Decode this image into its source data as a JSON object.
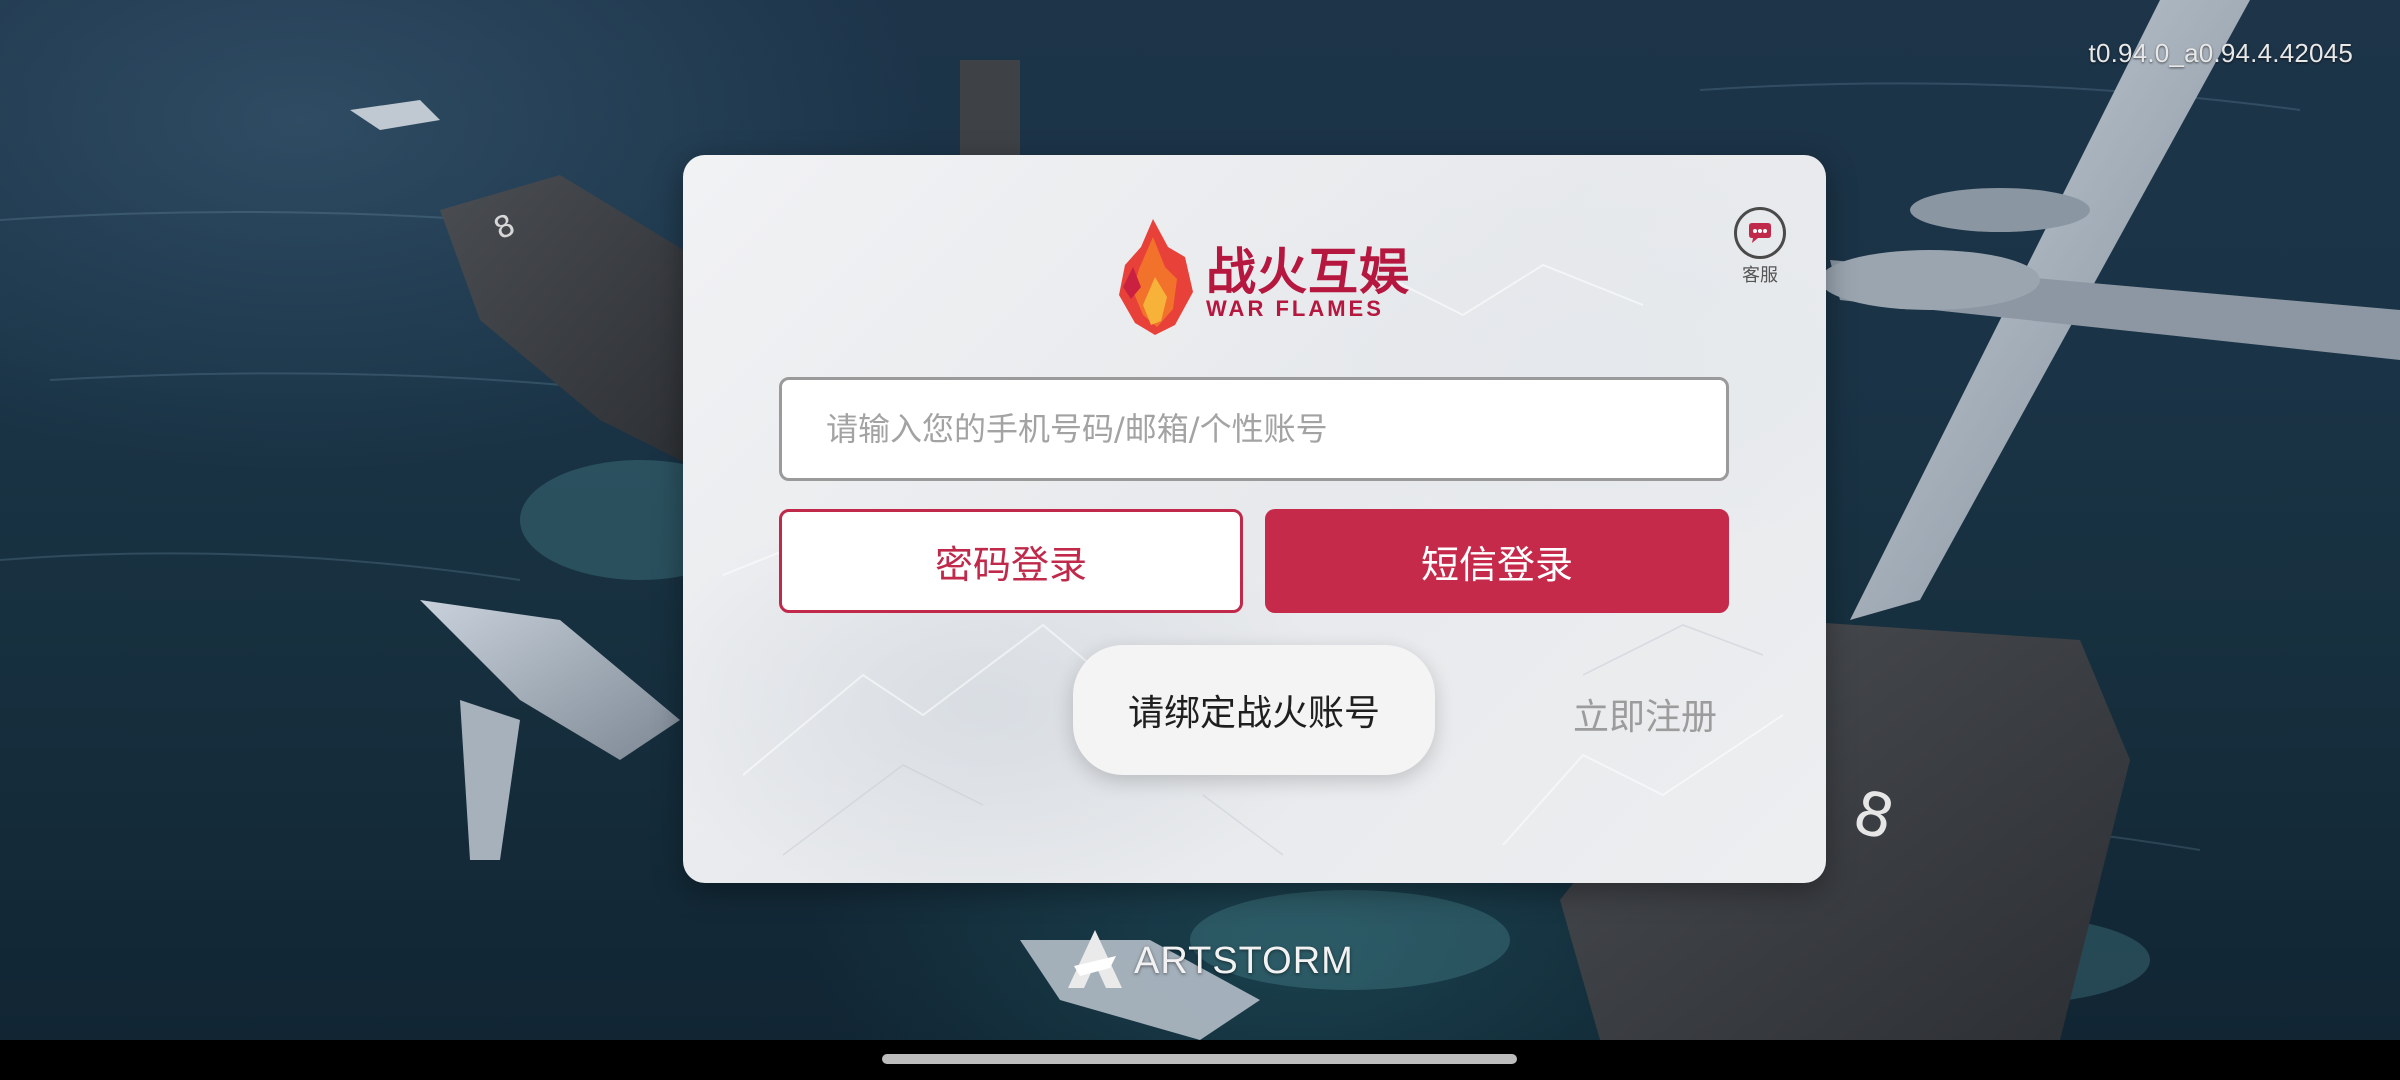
{
  "status": {
    "version": "t0.94.0_a0.94.4.42045"
  },
  "logo": {
    "name_cn": "战火互娱",
    "name_en": "WAR FLAMES",
    "icon": "flame-logo-icon"
  },
  "service": {
    "label": "客服",
    "icon": "customer-service-icon"
  },
  "login": {
    "account_placeholder": "请输入您的手机号码/邮箱/个性账号",
    "account_value": "",
    "password_login_label": "密码登录",
    "sms_login_label": "短信登录",
    "register_label": "立即注册"
  },
  "toast": {
    "message": "请绑定战火账号"
  },
  "brand": {
    "name": "ARTSTORM",
    "icon": "artstorm-logo-icon"
  },
  "colors": {
    "accent": "#c52a4b",
    "placeholder": "#a3a3a3",
    "register_text": "#9c9c9c"
  }
}
